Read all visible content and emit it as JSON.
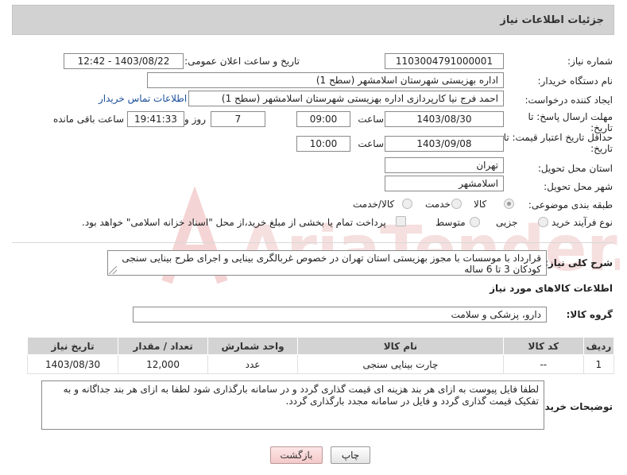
{
  "header": {
    "title": "جزئیات اطلاعات نیاز"
  },
  "fields": {
    "need_number": {
      "label": "شماره نیاز:",
      "value": "1103004791000001"
    },
    "announce_datetime": {
      "label": "تاریخ و ساعت اعلان عمومی:",
      "value": "1403/08/22 - 12:42"
    },
    "buyer_org": {
      "label": "نام دستگاه خریدار:",
      "value": "اداره بهزیستی شهرستان اسلامشهر (سطح 1)"
    },
    "requester": {
      "label": "ایجاد کننده درخواست:",
      "value": "احمد  فرج نیا کارپردازی اداره بهزیستی شهرستان اسلامشهر (سطح 1)",
      "contact_link": "اطلاعات تماس خریدار"
    },
    "reply_deadline": {
      "label_line1": "مهلت ارسال پاسخ: تا",
      "label_line2": "تاریخ:",
      "date": "1403/08/30",
      "time_label": "ساعت",
      "time": "09:00",
      "days": "7",
      "days_label": "روز و",
      "remaining": "19:41:33",
      "remaining_label": "ساعت باقی مانده"
    },
    "price_validity": {
      "label_line1": "حداقل تاریخ اعتبار قیمت: تا",
      "label_line2": "تاریخ:",
      "date": "1403/09/08",
      "time_label": "ساعت",
      "time": "10:00"
    },
    "province": {
      "label": "استان محل تحویل:",
      "value": "تهران"
    },
    "city": {
      "label": "شهر محل تحویل:",
      "value": "اسلامشهر"
    },
    "category": {
      "label": "طبقه بندی موضوعی:",
      "options": [
        "کالا",
        "خدمت",
        "کالا/خدمت"
      ],
      "selected": "کالا"
    },
    "purchase_process": {
      "label": "نوع فرآیند خرید :",
      "options": [
        "جزیی",
        "متوسط"
      ],
      "note": "پرداخت تمام یا بخشی از مبلغ خرید،از محل \"اسناد خزانه اسلامی\" خواهد بود."
    }
  },
  "description": {
    "label": "شرح کلی نیاز:",
    "value": "قرارداد با موسسات با مجوز بهزیستی استان تهران در خصوص غربالگری بینایی و اجرای طرح بینایی سنجی کودکان 3 تا 6 ساله"
  },
  "goods_section": {
    "title": "اطلاعات کالاهای مورد نیاز",
    "group_label": "گروه کالا:",
    "group_value": "دارو، پزشکی و سلامت"
  },
  "table": {
    "headers": [
      "ردیف",
      "کد کالا",
      "نام کالا",
      "واحد شمارش",
      "تعداد / مقدار",
      "تاریخ نیاز"
    ],
    "rows": [
      [
        "1",
        "--",
        "چارت بینایی سنجی",
        "عدد",
        "12,000",
        "1403/08/30"
      ]
    ]
  },
  "buyer_notes": {
    "label": "توضیحات خریدار:",
    "value": "لطفا فایل پیوست به ازای هر بند هزینه ای قیمت گذاری گردد و در سامانه بارگذاری شود لطفا به ازای هر بند جداگانه و به تفکیک قیمت گذاری گردد و فایل در سامانه مجدد بارگذاری گردد."
  },
  "buttons": {
    "print": "چاپ",
    "back": "بازگشت"
  },
  "watermark": {
    "text": "AriaTender.net"
  },
  "colors": {
    "header_bg": "#d2d2d2",
    "link": "#1a4f9c",
    "watermark": "#f2c9c9",
    "back_button": "#f4c9c9"
  }
}
